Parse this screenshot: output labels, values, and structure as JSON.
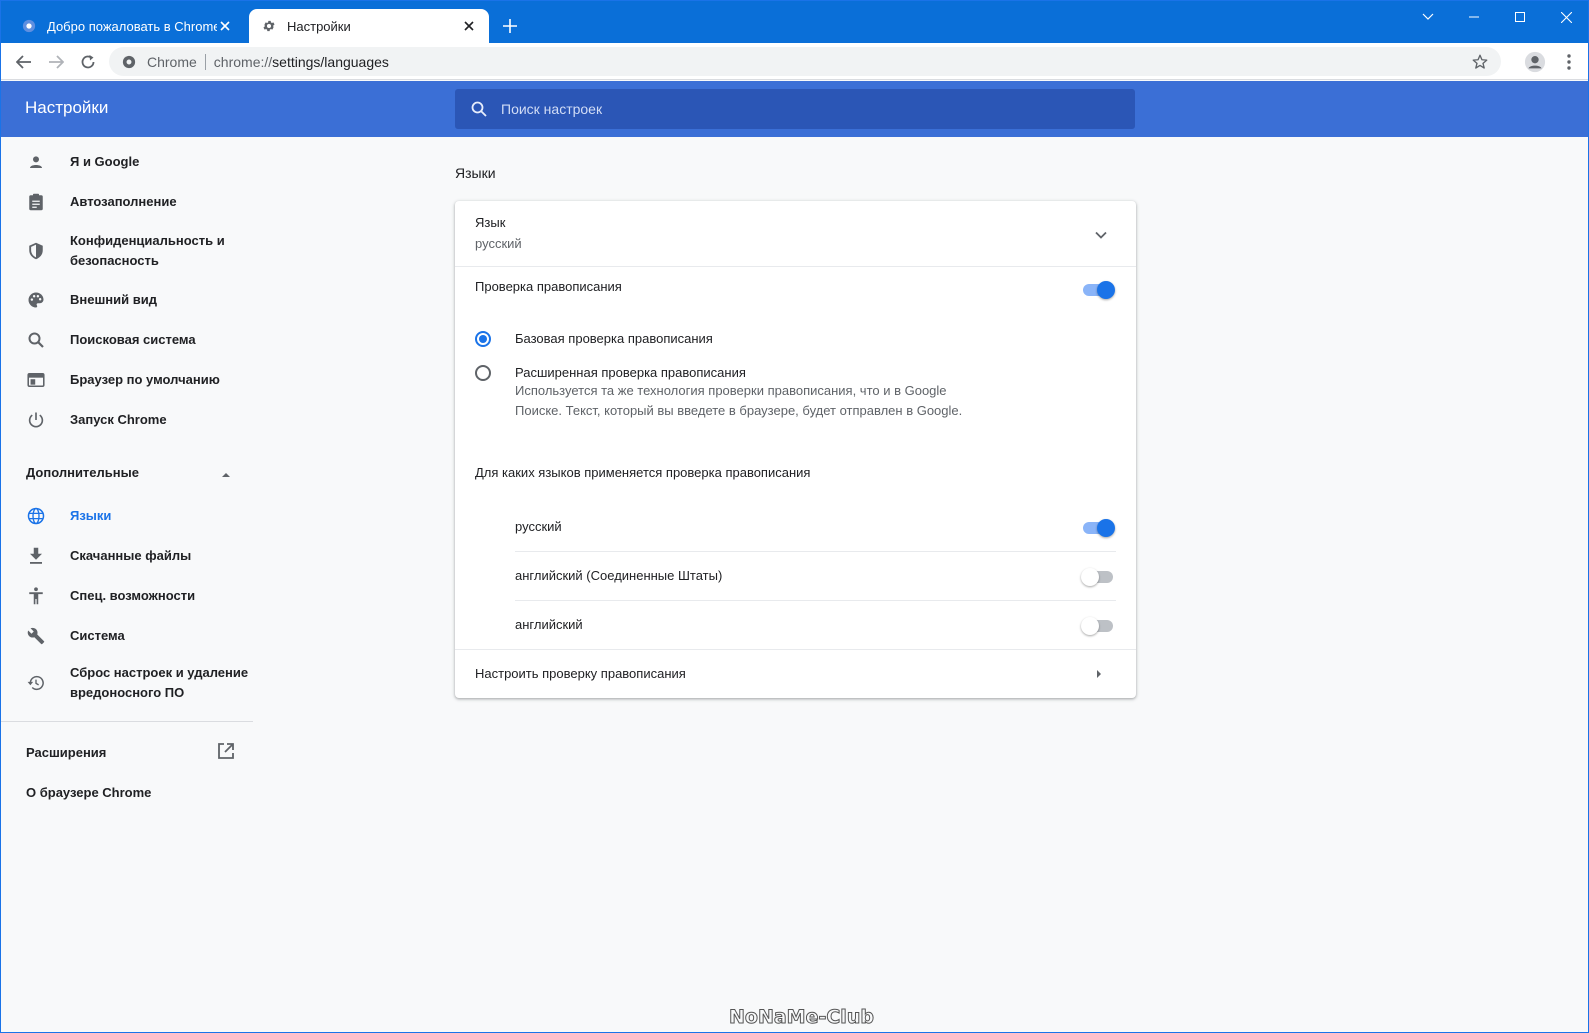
{
  "browser": {
    "tabs": [
      {
        "title": "Добро пожаловать в Chrome!",
        "active": false
      },
      {
        "title": "Настройки",
        "active": true
      }
    ],
    "omnibox": {
      "site_name": "Chrome",
      "url_scheme": "chrome://",
      "url_path": "settings/languages"
    }
  },
  "header": {
    "title": "Настройки",
    "search_placeholder": "Поиск настроек"
  },
  "sidebar": {
    "items": [
      {
        "label": "Я и Google",
        "icon": "person-icon"
      },
      {
        "label": "Автозаполнение",
        "icon": "clipboard-icon"
      },
      {
        "label": "Конфиденциальность и безопасность",
        "icon": "shield-icon"
      },
      {
        "label": "Внешний вид",
        "icon": "palette-icon"
      },
      {
        "label": "Поисковая система",
        "icon": "search-icon"
      },
      {
        "label": "Браузер по умолчанию",
        "icon": "browser-icon"
      },
      {
        "label": "Запуск Chrome",
        "icon": "power-icon"
      }
    ],
    "advanced_header": "Дополнительные",
    "advanced_items": [
      {
        "label": "Языки",
        "icon": "globe-icon",
        "selected": true
      },
      {
        "label": "Скачанные файлы",
        "icon": "download-icon"
      },
      {
        "label": "Спец. возможности",
        "icon": "accessibility-icon"
      },
      {
        "label": "Система",
        "icon": "wrench-icon"
      },
      {
        "label": "Сброс настроек и удаление вредоносного ПО",
        "icon": "restore-icon"
      }
    ],
    "extensions": "Расширения",
    "about": "О браузере Chrome"
  },
  "main": {
    "section_title": "Языки",
    "language": {
      "label": "Язык",
      "value": "русский"
    },
    "spellcheck": {
      "label": "Проверка правописания",
      "enabled": true,
      "basic_label": "Базовая проверка правописания",
      "enhanced_label": "Расширенная проверка правописания",
      "enhanced_desc": "Используется та же технология проверки правописания, что и в Google Поиске. Текст, который вы введете в браузере, будет отправлен в Google.",
      "selected": "basic",
      "languages_title": "Для каких языков применяется проверка правописания",
      "languages": [
        {
          "name": "русский",
          "enabled": true
        },
        {
          "name": "английский (Соединенные Штаты)",
          "enabled": false
        },
        {
          "name": "английский",
          "enabled": false
        }
      ],
      "customize_label": "Настроить проверку правописания"
    }
  },
  "watermark": "NoNaMe-Club",
  "colors": {
    "accent": "#1a73e8",
    "header": "#3b6fd6",
    "tabstrip": "#0a6fd8"
  }
}
